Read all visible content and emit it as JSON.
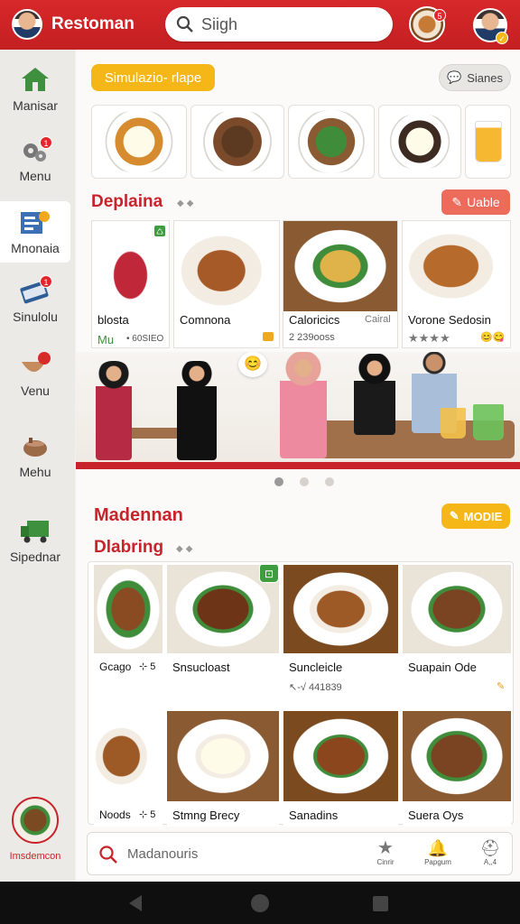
{
  "header": {
    "brand": "Restoman",
    "search_placeholder": "Siigh"
  },
  "sidebar": {
    "items": [
      {
        "label": "Manisar",
        "icon": "home-icon"
      },
      {
        "label": "Menu",
        "icon": "gears-icon",
        "badge": "1"
      },
      {
        "label": "Mnonaia",
        "icon": "menu-board-icon"
      },
      {
        "label": "Sinulolu",
        "icon": "card-icon",
        "badge": "1"
      },
      {
        "label": "Venu",
        "icon": "bowl-icon"
      },
      {
        "label": "Mehu",
        "icon": "pot-icon"
      },
      {
        "label": "Sipednar",
        "icon": "truck-icon"
      }
    ],
    "profile_label": "Imsdemcon"
  },
  "top_section": {
    "pill_label": "Simulazio- rlape",
    "right_pill_label": "Sianes"
  },
  "section1": {
    "title": "Deplaina",
    "action_label": "Uable"
  },
  "cards1": [
    {
      "name": "blosta",
      "sub1": "Mu",
      "sub2": "• 60SIEO"
    },
    {
      "name": "Comnona",
      "sub1": "",
      "sub2": ""
    },
    {
      "name": "Caloricics",
      "right": "Cairal",
      "sub1": "2 239ooss"
    },
    {
      "name": "Vorone Sedosin",
      "rating": "★★★★"
    }
  ],
  "section2": {
    "title": "Madennan",
    "action_label": "MODIE",
    "subtitle": "Dlabring"
  },
  "grid": [
    {
      "name": "Gcago",
      "extra": "⊹ 5"
    },
    {
      "name": "Snsucloast"
    },
    {
      "name": "Suncleicle",
      "sub": "↖-√ 441839"
    },
    {
      "name": "Suapain Ode"
    },
    {
      "name": "Noods",
      "extra": "⊹ 5"
    },
    {
      "name": "Stmng Brecy"
    },
    {
      "name": "Sanadins"
    },
    {
      "name": "Suera Oys"
    }
  ],
  "bottom_search": {
    "placeholder": "Madanouris",
    "actions": [
      "Cinrir",
      "Papgum",
      "A,,4"
    ]
  },
  "colors": {
    "primary": "#c8232a",
    "accent_yellow": "#f4b717",
    "accent_salmon": "#ec6b5a"
  }
}
